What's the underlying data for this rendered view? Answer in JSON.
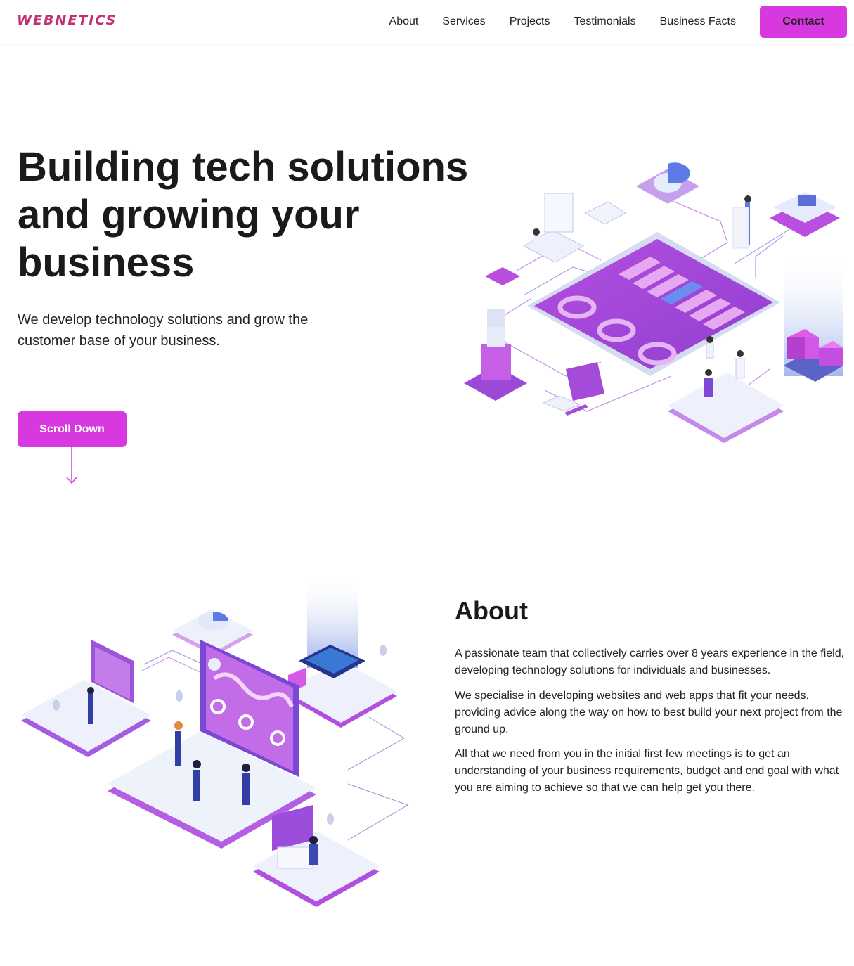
{
  "brand": {
    "logo_text": "WEBNETICS",
    "accent_color": "#d838e0",
    "logo_color": "#c4306f"
  },
  "nav": {
    "items": [
      "About",
      "Services",
      "Projects",
      "Testimonials",
      "Business Facts"
    ],
    "contact_label": "Contact"
  },
  "hero": {
    "title": "Building tech solutions and growing your business",
    "subtitle": "We develop technology solutions and grow the customer base of your business.",
    "scroll_label": "Scroll Down",
    "illustration_icon": "isometric-dashboard-illustration",
    "arrow_icon": "arrow-down-icon"
  },
  "about": {
    "title": "About",
    "paragraphs": [
      "A passionate team that collectively carries over 8 years experience in the field, developing technology solutions for individuals and businesses.",
      "We specialise in developing websites and web apps that fit your needs, providing advice along the way on how to best build your next project from the ground up.",
      "All that we need from you in the initial first few meetings is to get an understanding of your business requirements, budget and end goal with what you are aiming to achieve so that we can help get you there."
    ],
    "illustration_icon": "isometric-team-illustration"
  }
}
